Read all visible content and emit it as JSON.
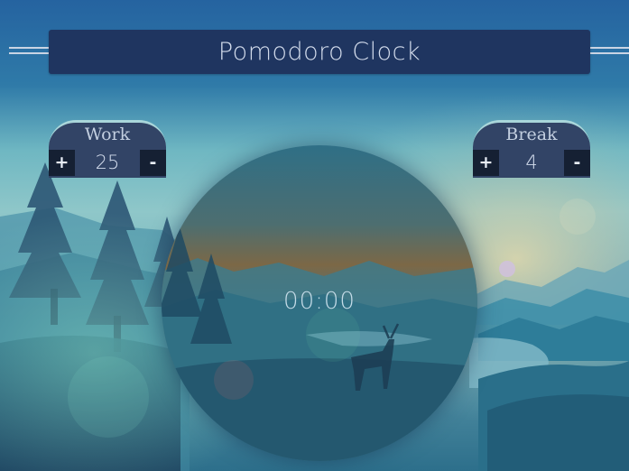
{
  "header": {
    "title": "Pomodoro Clock"
  },
  "work": {
    "label": "Work",
    "value": "25",
    "increment_label": "+",
    "decrement_label": "-"
  },
  "break": {
    "label": "Break",
    "value": "4",
    "increment_label": "+",
    "decrement_label": "-"
  },
  "clock": {
    "time": "00:00"
  },
  "colors": {
    "title_bar": "#1f3560",
    "adjuster_bg": "#324466",
    "adjuster_border": "#a9d6da",
    "button_bg": "#152033",
    "text_light": "#c3cfe0"
  },
  "icons": {
    "increment": "plus-icon",
    "decrement": "minus-icon"
  }
}
